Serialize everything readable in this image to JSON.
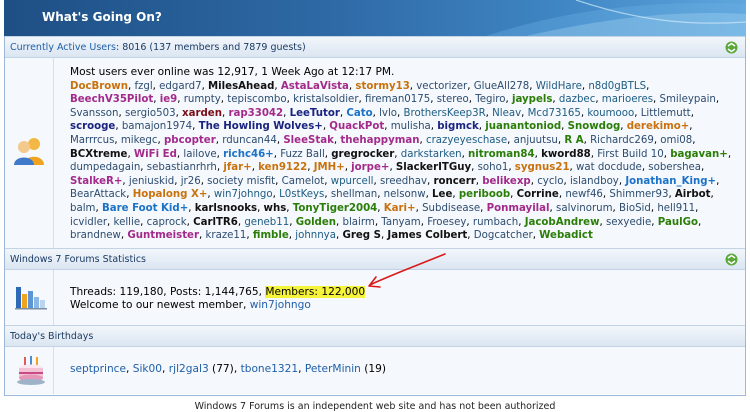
{
  "header": {
    "title": "What's Going On?"
  },
  "active_users": {
    "label": "Currently Active Users",
    "summary": ": 8016 (137 members and 7879 guests)",
    "record_line": "Most users ever online was 12,917, 1 Week Ago at 12:17 PM.",
    "users": [
      {
        "n": "DocBrown",
        "c": "u-orange"
      },
      {
        "n": "fzgl",
        "c": "u-gray"
      },
      {
        "n": "edgard7",
        "c": "u-gray"
      },
      {
        "n": "MilesAhead",
        "c": "u-black"
      },
      {
        "n": "AstaLaVista",
        "c": "u-purple"
      },
      {
        "n": "stormy13",
        "c": "u-orange"
      },
      {
        "n": "vectorizer",
        "c": "u-gray"
      },
      {
        "n": "GlueAll278",
        "c": "u-gray"
      },
      {
        "n": "WildHare",
        "c": "u-teal"
      },
      {
        "n": "n8d0gBTLS",
        "c": "u-teal"
      },
      {
        "n": "BeechV35Pilot",
        "c": "u-purple"
      },
      {
        "n": "ie9",
        "c": "u-purple"
      },
      {
        "n": "rumpty",
        "c": "u-gray"
      },
      {
        "n": "tepiscombo",
        "c": "u-gray"
      },
      {
        "n": "kristalsoldier",
        "c": "u-gray"
      },
      {
        "n": "fireman0175",
        "c": "u-gray"
      },
      {
        "n": "stereo",
        "c": "u-gray"
      },
      {
        "n": "Tegiro",
        "c": "u-gray"
      },
      {
        "n": "jaypels",
        "c": "u-green"
      },
      {
        "n": "dazbec",
        "c": "u-teal"
      },
      {
        "n": "marioeres",
        "c": "u-teal"
      },
      {
        "n": "Smileypain",
        "c": "u-gray"
      },
      {
        "n": "Svansson",
        "c": "u-gray"
      },
      {
        "n": "sergio503",
        "c": "u-gray"
      },
      {
        "n": "xarden",
        "c": "u-darkred"
      },
      {
        "n": "rap33042",
        "c": "u-purple"
      },
      {
        "n": "LeeTutor",
        "c": "u-navy"
      },
      {
        "n": "Cato",
        "c": "u-blue"
      },
      {
        "n": "lvlo",
        "c": "u-gray"
      },
      {
        "n": "BrothersKeep3R",
        "c": "u-teal"
      },
      {
        "n": "Nleav",
        "c": "u-teal"
      },
      {
        "n": "Mcd73165",
        "c": "u-teal"
      },
      {
        "n": "koumooo",
        "c": "u-teal"
      },
      {
        "n": "Littlemutt",
        "c": "u-gray"
      },
      {
        "n": "scrooge",
        "c": "u-navy"
      },
      {
        "n": "bamajon1974",
        "c": "u-gray"
      },
      {
        "n": "The Howling Wolves+",
        "c": "u-navy"
      },
      {
        "n": "QuackPot",
        "c": "u-purple"
      },
      {
        "n": "mulisha",
        "c": "u-gray"
      },
      {
        "n": "bigmck",
        "c": "u-navy"
      },
      {
        "n": "juanantoniod",
        "c": "u-green"
      },
      {
        "n": "Snowdog",
        "c": "u-green"
      },
      {
        "n": "derekimo+",
        "c": "u-orange"
      },
      {
        "n": "Marrrcus",
        "c": "u-gray"
      },
      {
        "n": "mikegc",
        "c": "u-gray"
      },
      {
        "n": "pbcopter",
        "c": "u-purple"
      },
      {
        "n": "rduncan44",
        "c": "u-gray"
      },
      {
        "n": "SleeStak",
        "c": "u-purple"
      },
      {
        "n": "thehappyman",
        "c": "u-purple"
      },
      {
        "n": "crazyeyeschase",
        "c": "u-teal"
      },
      {
        "n": "anjuutsu",
        "c": "u-gray"
      },
      {
        "n": "R A",
        "c": "u-green"
      },
      {
        "n": "Richardc269",
        "c": "u-gray"
      },
      {
        "n": "omi08",
        "c": "u-gray"
      },
      {
        "n": "BCXtreme",
        "c": "u-black"
      },
      {
        "n": "WiFi Ed",
        "c": "u-purple"
      },
      {
        "n": "lailove",
        "c": "u-gray"
      },
      {
        "n": "richc46+",
        "c": "u-blue"
      },
      {
        "n": "Fuzz Ball",
        "c": "u-gray"
      },
      {
        "n": "gregrocker",
        "c": "u-black"
      },
      {
        "n": "darkstarken",
        "c": "u-teal"
      },
      {
        "n": "nitroman84",
        "c": "u-green"
      },
      {
        "n": "kword88",
        "c": "u-black"
      },
      {
        "n": "First Build 10",
        "c": "u-gray"
      },
      {
        "n": "bagavan+",
        "c": "u-green"
      },
      {
        "n": "dumpedagain",
        "c": "u-gray"
      },
      {
        "n": "sebastianrhrh",
        "c": "u-gray"
      },
      {
        "n": "jfar+",
        "c": "u-orange"
      },
      {
        "n": "ken9122",
        "c": "u-orange"
      },
      {
        "n": "JMH+",
        "c": "u-orange"
      },
      {
        "n": "jorpe+",
        "c": "u-purple"
      },
      {
        "n": "SlackerITGuy",
        "c": "u-black"
      },
      {
        "n": "soho1",
        "c": "u-gray"
      },
      {
        "n": "sygnus21",
        "c": "u-orange"
      },
      {
        "n": "wat docdude",
        "c": "u-gray"
      },
      {
        "n": "sobershea",
        "c": "u-gray"
      },
      {
        "n": "StalkeR+",
        "c": "u-purple"
      },
      {
        "n": "jeniuskid",
        "c": "u-gray"
      },
      {
        "n": "jr26",
        "c": "u-gray"
      },
      {
        "n": "society misfit",
        "c": "u-gray"
      },
      {
        "n": "Camelot",
        "c": "u-gray"
      },
      {
        "n": "wpurcell",
        "c": "u-teal"
      },
      {
        "n": "sreedhav",
        "c": "u-gray"
      },
      {
        "n": "roncerr",
        "c": "u-black"
      },
      {
        "n": "belikexp",
        "c": "u-purple"
      },
      {
        "n": "cyclo",
        "c": "u-gray"
      },
      {
        "n": "islandboy",
        "c": "u-gray"
      },
      {
        "n": "Jonathan_King+",
        "c": "u-blue"
      },
      {
        "n": "BearAttack",
        "c": "u-gray"
      },
      {
        "n": "Hopalong X+",
        "c": "u-orange"
      },
      {
        "n": "win7johngo",
        "c": "u-teal"
      },
      {
        "n": "L0stKeys",
        "c": "u-teal"
      },
      {
        "n": "shellman",
        "c": "u-gray"
      },
      {
        "n": "nelsonw",
        "c": "u-gray"
      },
      {
        "n": "Lee",
        "c": "u-black"
      },
      {
        "n": "periboob",
        "c": "u-green"
      },
      {
        "n": "Corrine",
        "c": "u-black"
      },
      {
        "n": "newf46",
        "c": "u-gray"
      },
      {
        "n": "Shimmer93",
        "c": "u-gray"
      },
      {
        "n": "Airbot",
        "c": "u-black"
      },
      {
        "n": "balm",
        "c": "u-gray"
      },
      {
        "n": "Bare Foot Kid+",
        "c": "u-blue"
      },
      {
        "n": "karlsnooks",
        "c": "u-black"
      },
      {
        "n": "whs",
        "c": "u-black"
      },
      {
        "n": "TonyTiger2004",
        "c": "u-green"
      },
      {
        "n": "Kari+",
        "c": "u-orange"
      },
      {
        "n": "Subdisease",
        "c": "u-gray"
      },
      {
        "n": "Ponmayilal",
        "c": "u-purple"
      },
      {
        "n": "salvinorum",
        "c": "u-gray"
      },
      {
        "n": "BioSid",
        "c": "u-gray"
      },
      {
        "n": "hell911",
        "c": "u-gray"
      },
      {
        "n": "icvidler",
        "c": "u-gray"
      },
      {
        "n": "kellie",
        "c": "u-gray"
      },
      {
        "n": "caprock",
        "c": "u-gray"
      },
      {
        "n": "CarlTR6",
        "c": "u-black"
      },
      {
        "n": "geneb11",
        "c": "u-teal"
      },
      {
        "n": "Golden",
        "c": "u-green"
      },
      {
        "n": "blairm",
        "c": "u-gray"
      },
      {
        "n": "Tanyam",
        "c": "u-gray"
      },
      {
        "n": "Froesey",
        "c": "u-gray"
      },
      {
        "n": "rumbach",
        "c": "u-gray"
      },
      {
        "n": "JacobAndrew",
        "c": "u-green"
      },
      {
        "n": "sexyedie",
        "c": "u-gray"
      },
      {
        "n": "PaulGo",
        "c": "u-green"
      },
      {
        "n": "brandnew",
        "c": "u-gray"
      },
      {
        "n": "Guntmeister",
        "c": "u-purple"
      },
      {
        "n": "kraze11",
        "c": "u-gray"
      },
      {
        "n": "fimble",
        "c": "u-green"
      },
      {
        "n": "johnnya",
        "c": "u-teal"
      },
      {
        "n": "Greg S",
        "c": "u-black"
      },
      {
        "n": "James Colbert",
        "c": "u-black"
      },
      {
        "n": "Dogcatcher",
        "c": "u-gray"
      },
      {
        "n": "Webadict",
        "c": "u-green"
      }
    ]
  },
  "stats": {
    "label": "Windows 7 Forums Statistics",
    "threads_posts": "Threads: 119,180, Posts: 1,144,765, ",
    "members": "Members: 122,000",
    "welcome": "Welcome to our newest member, ",
    "newest_member": "win7johngo"
  },
  "birthdays": {
    "label": "Today's Birthdays",
    "entries": [
      {
        "name": "septprince",
        "age": ""
      },
      {
        "name": "Sik00",
        "age": ""
      },
      {
        "name": "rjl2gal3",
        "age": " (77)"
      },
      {
        "name": "tbone1321",
        "age": ""
      },
      {
        "name": "PeterMinin",
        "age": " (19)"
      }
    ]
  },
  "footer": {
    "text": "Windows 7 Forums is an independent web site and has not been authorized"
  },
  "colors": {
    "title_bar": "#2f6aa6",
    "section_bg": "#dbe6f2",
    "highlight": "#f6f33b",
    "arrow": "#d91a1a"
  }
}
